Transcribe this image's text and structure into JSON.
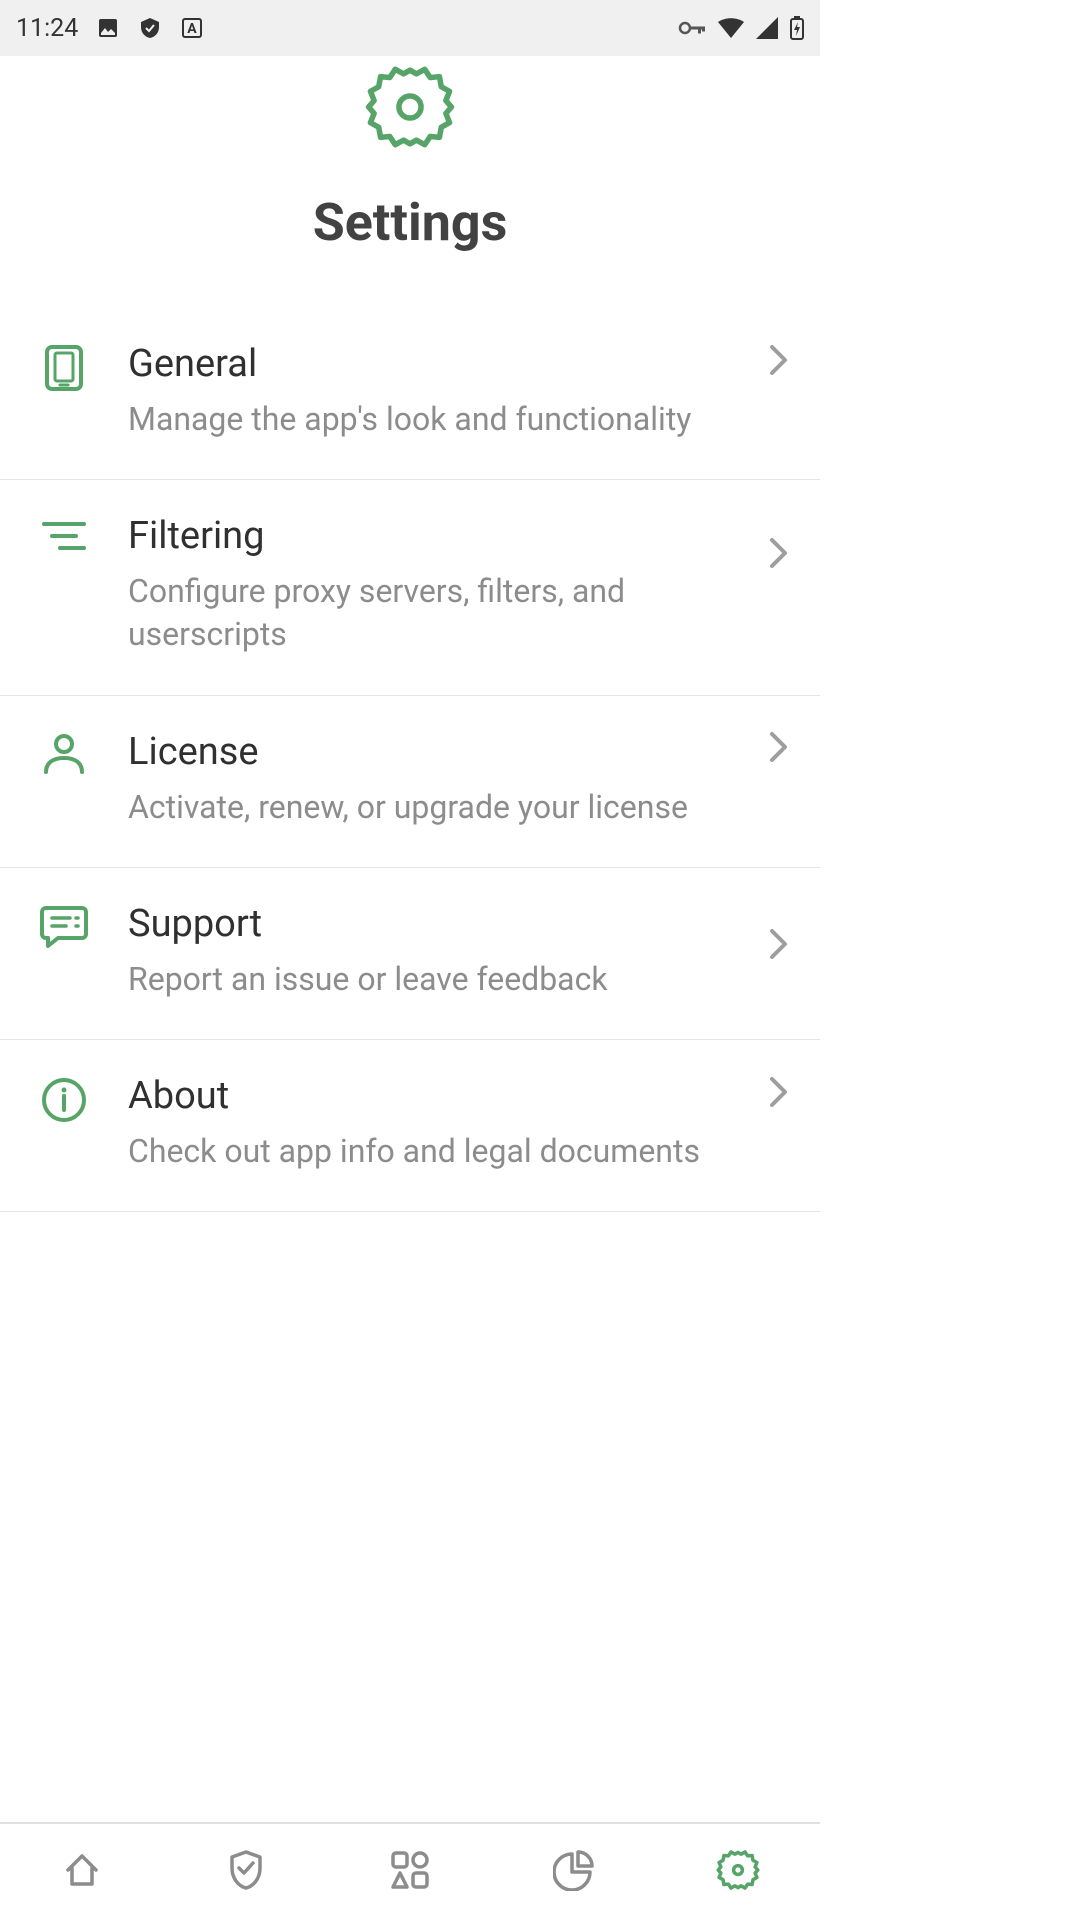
{
  "status": {
    "time": "11:24"
  },
  "header": {
    "title": "Settings"
  },
  "items": [
    {
      "title": "General",
      "subtitle": "Manage the app's look and functionality"
    },
    {
      "title": "Filtering",
      "subtitle": "Configure proxy servers, filters, and userscripts"
    },
    {
      "title": "License",
      "subtitle": "Activate, renew, or upgrade your license"
    },
    {
      "title": "Support",
      "subtitle": "Report an issue or leave feedback"
    },
    {
      "title": "About",
      "subtitle": "Check out app info and legal documents"
    }
  ],
  "colors": {
    "accent": "#56a468",
    "text": "#303030",
    "muted": "#8c8c8c",
    "chevron": "#9e9e9e"
  }
}
